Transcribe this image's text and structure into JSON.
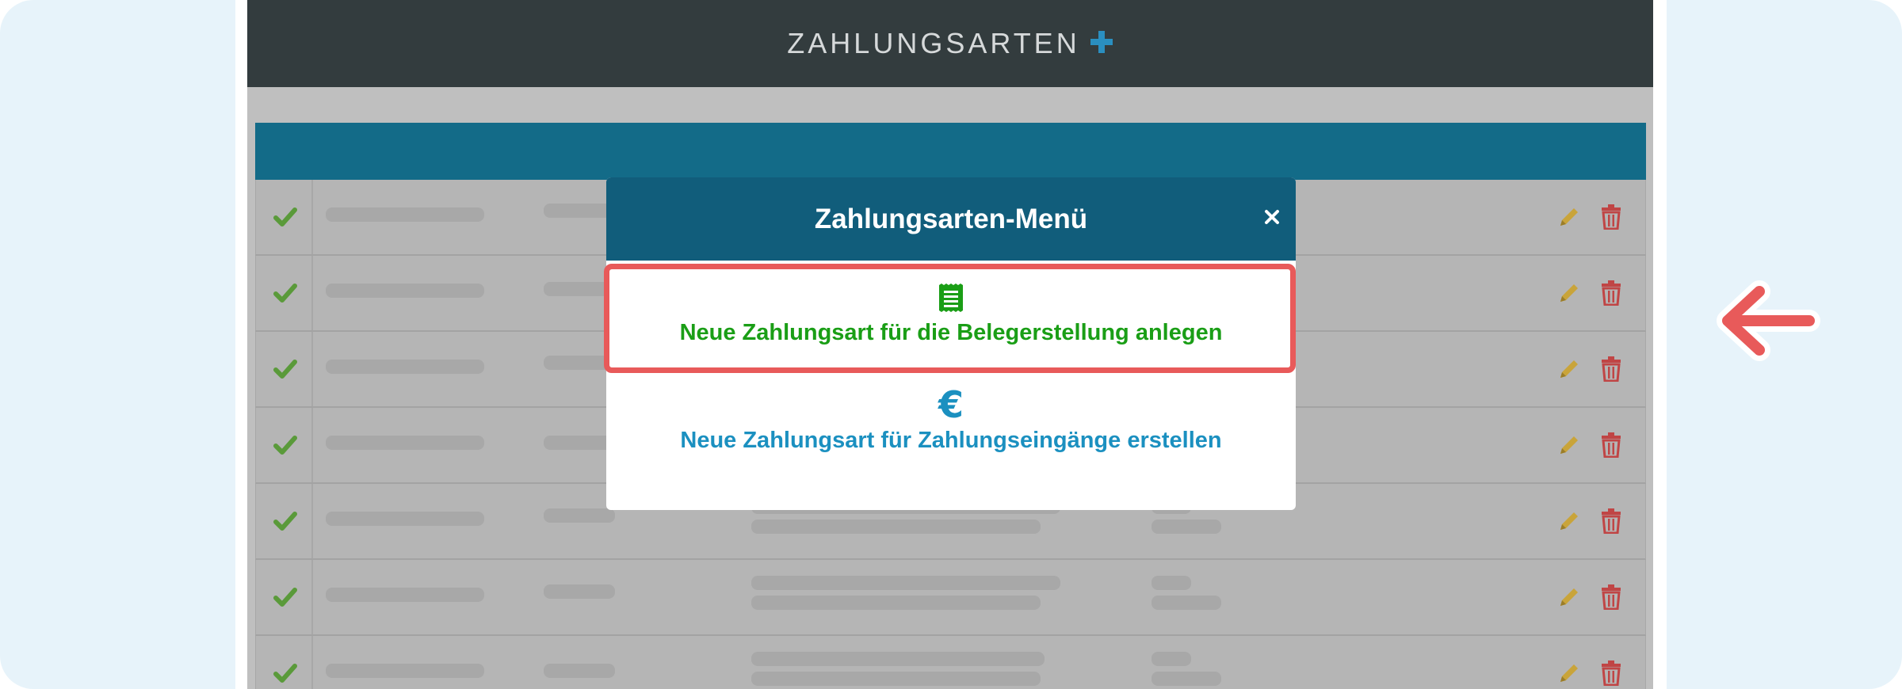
{
  "app": {
    "title": "ZAHLUNGSARTEN",
    "accent_color": "#2a8fc0",
    "header_color": "#333c3e"
  },
  "table": {
    "header_color": "#136b88",
    "row_count_visible": 7
  },
  "modal": {
    "title": "Zahlungsarten-Menü",
    "close_icon": "close-icon",
    "options": [
      {
        "icon": "receipt-icon",
        "label": "Neue Zahlungsart für die Belegerstellung anlegen",
        "color": "#1a9e16",
        "highlighted": true
      },
      {
        "icon": "euro-icon",
        "icon_glyph": "€",
        "label": "Neue Zahlungsart für Zahlungseingänge erstellen",
        "color": "#1b90c0",
        "highlighted": false
      }
    ]
  },
  "annotation": {
    "highlight_color": "#e85a5a",
    "pointer_icon": "arrow-left-icon"
  }
}
